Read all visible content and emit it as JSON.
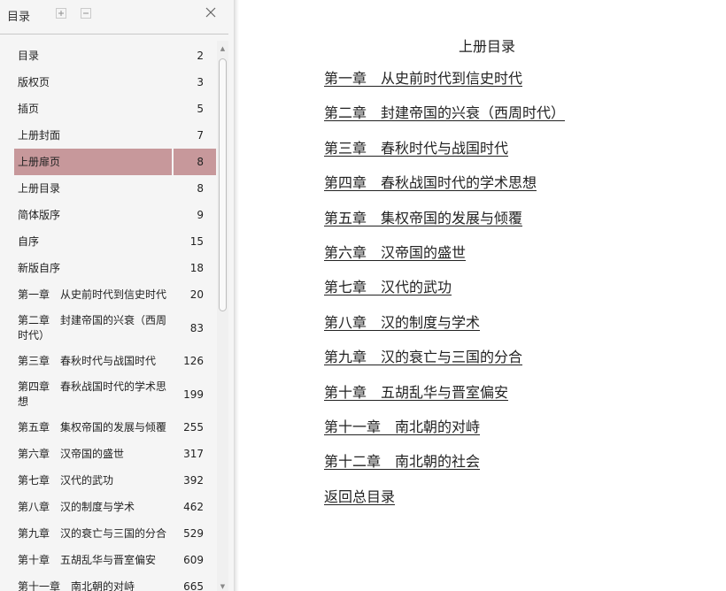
{
  "sidebar": {
    "title": "目录",
    "toc": [
      {
        "label": "目录",
        "page": "2"
      },
      {
        "label": "版权页",
        "page": "3"
      },
      {
        "label": "插页",
        "page": "5"
      },
      {
        "label": "上册封面",
        "page": "7"
      },
      {
        "label": "上册扉页",
        "page": "8",
        "selected": true
      },
      {
        "label": "上册目录",
        "page": "8"
      },
      {
        "label": "简体版序",
        "page": "9"
      },
      {
        "label": "自序",
        "page": "15"
      },
      {
        "label": "新版自序",
        "page": "18"
      },
      {
        "label": "第一章　从史前时代到信史时代",
        "page": "20"
      },
      {
        "label": "第二章　封建帝国的兴衰（西周时代）",
        "page": "83",
        "tall": true
      },
      {
        "label": "第三章　春秋时代与战国时代",
        "page": "126"
      },
      {
        "label": "第四章　春秋战国时代的学术思想",
        "page": "199",
        "tall": true
      },
      {
        "label": "第五章　集权帝国的发展与倾覆",
        "page": "255"
      },
      {
        "label": "第六章　汉帝国的盛世",
        "page": "317"
      },
      {
        "label": "第七章　汉代的武功",
        "page": "392"
      },
      {
        "label": "第八章　汉的制度与学术",
        "page": "462"
      },
      {
        "label": "第九章　汉的衰亡与三国的分合",
        "page": "529"
      },
      {
        "label": "第十章　五胡乱华与晋室偏安",
        "page": "609"
      },
      {
        "label": "第十一章　南北朝的对峙",
        "page": "665"
      }
    ]
  },
  "document": {
    "title": "上册目录",
    "chapters": [
      "第一章　从史前时代到信史时代",
      "第二章　封建帝国的兴衰（西周时代）",
      "第三章　春秋时代与战国时代",
      "第四章　春秋战国时代的学术思想",
      "第五章　集权帝国的发展与倾覆",
      "第六章　汉帝国的盛世",
      "第七章　汉代的武功",
      "第八章　汉的制度与学术",
      "第九章　汉的衰亡与三国的分合",
      "第十章　五胡乱华与晋室偏安",
      "第十一章　南北朝的对峙",
      "第十二章　南北朝的社会",
      "返回总目录"
    ]
  },
  "icons": {
    "expand": "expand-all-icon",
    "collapse": "collapse-all-icon",
    "close": "close-icon"
  }
}
